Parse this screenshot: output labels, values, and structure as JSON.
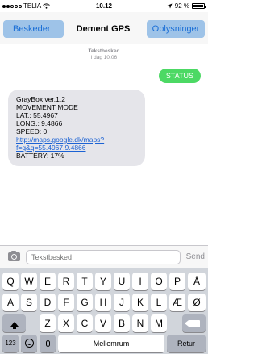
{
  "status_bar": {
    "carrier": "TELIA",
    "time": "10.12",
    "battery": "92 %",
    "signal_bars": 2,
    "signal_total": 5
  },
  "nav": {
    "back_label": "Beskeder",
    "title": "Dement GPS",
    "info_label": "Oplysninger"
  },
  "messages": {
    "timestamp_type": "Tekstbesked",
    "timestamp_date": "i dag 10.06",
    "outgoing": "STATUS",
    "incoming": {
      "line1": "GrayBox ver.1,2",
      "line2": "MOVEMENT MODE",
      "line3": "LAT.: 55.4967",
      "line4": "LONG.: 9.4866",
      "line5": "SPEED: 0",
      "link_line1": "http://maps.google.dk/maps?",
      "link_line2": "f=q&q=55.4967,9.4866",
      "line6": "BATTERY: 17%"
    }
  },
  "compose": {
    "placeholder": "Tekstbesked",
    "send_label": "Send"
  },
  "keyboard": {
    "row1": [
      "Q",
      "W",
      "E",
      "R",
      "T",
      "Y",
      "U",
      "I",
      "O",
      "P",
      "Å"
    ],
    "row2": [
      "A",
      "S",
      "D",
      "F",
      "G",
      "H",
      "J",
      "K",
      "L",
      "Æ",
      "Ø"
    ],
    "row3": [
      "Z",
      "X",
      "C",
      "V",
      "B",
      "N",
      "M"
    ],
    "numbers_label": "123",
    "space_label": "Mellemrum",
    "return_label": "Retur"
  },
  "colors": {
    "accent": "#1b6fd6",
    "outgoing_bubble": "#4cd964",
    "incoming_bubble": "#e5e5ea"
  }
}
